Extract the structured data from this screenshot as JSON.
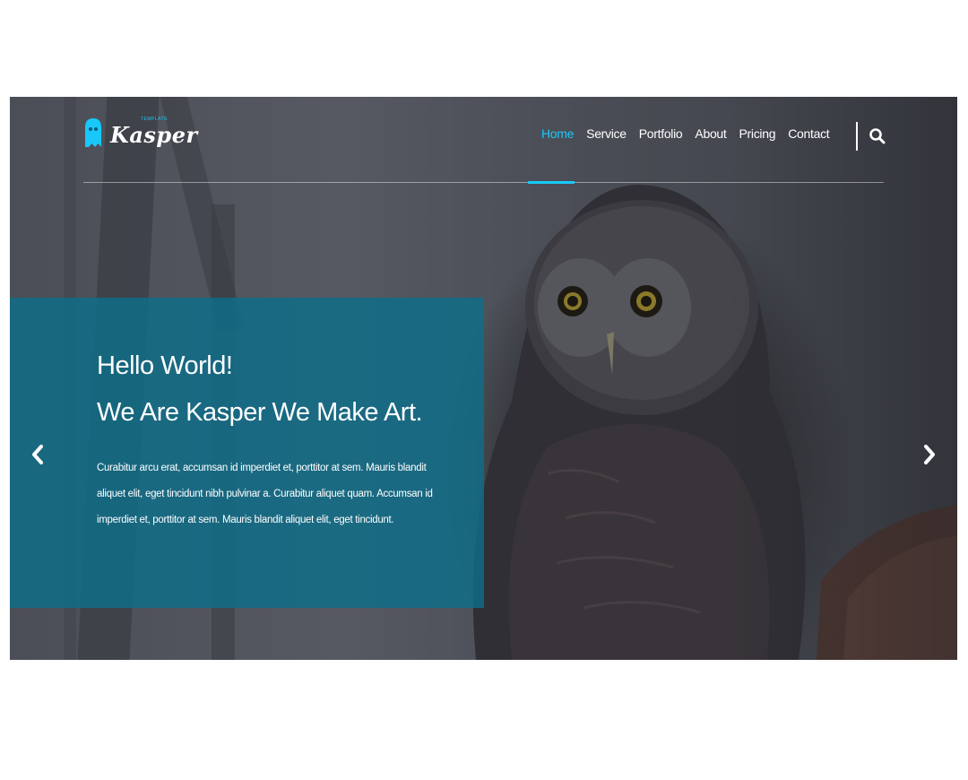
{
  "brand": {
    "name": "Kasper",
    "tagline": "TEMPLATE",
    "accent": "#19c8fa"
  },
  "nav": {
    "items": [
      {
        "label": "Home",
        "active": true
      },
      {
        "label": "Service",
        "active": false
      },
      {
        "label": "Portfolio",
        "active": false
      },
      {
        "label": "About",
        "active": false
      },
      {
        "label": "Pricing",
        "active": false
      },
      {
        "label": "Contact",
        "active": false
      }
    ],
    "search_icon": "search-icon"
  },
  "slider": {
    "heading_line1": "Hello World!",
    "heading_line2": "We Are Kasper We Make Art.",
    "body": "Curabitur arcu erat, accumsan id imperdiet et, porttitor at sem. Mauris blandit aliquet elit, eget tincidunt nibh pulvinar a. Curabitur aliquet quam. Accumsan id imperdiet et, porttitor at sem. Mauris blandit aliquet elit, eget tincidunt.",
    "prev_icon": "chevron-left-icon",
    "next_icon": "chevron-right-icon",
    "panel_color": "#0e6e8a"
  }
}
